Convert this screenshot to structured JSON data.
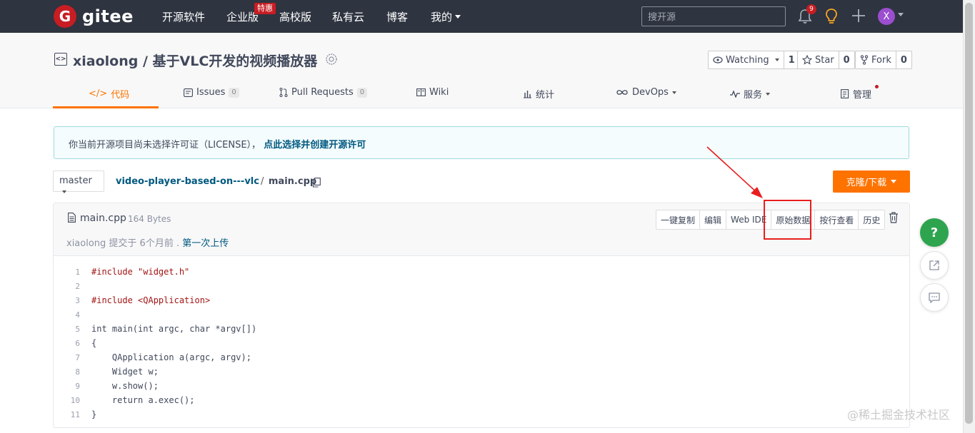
{
  "nav": {
    "logo_mark": "G",
    "logo_text": "gitee",
    "items": [
      "开源软件",
      "企业版",
      "高校版",
      "私有云",
      "博客",
      "我的"
    ],
    "enterprise_badge": "特惠",
    "search_placeholder": "搜开源",
    "notification_count": "9",
    "avatar_letter": "X"
  },
  "project": {
    "title": "xiaolong / 基于VLC开发的视频播放器",
    "watching_label": "Watching",
    "watching_count": "1",
    "star_label": "Star",
    "star_count": "0",
    "fork_label": "Fork",
    "fork_count": "0",
    "tabs": [
      {
        "label": "代码"
      },
      {
        "label": "Issues",
        "count": "0"
      },
      {
        "label": "Pull Requests",
        "count": "0"
      },
      {
        "label": "Wiki"
      },
      {
        "label": "统计"
      },
      {
        "label": "DevOps"
      },
      {
        "label": "服务"
      },
      {
        "label": "管理"
      }
    ]
  },
  "notice": {
    "text": "你当前开源项目尚未选择许可证（LICENSE），",
    "link": "点此选择并创建开源许可"
  },
  "repo": {
    "branch": "master",
    "path_dir": "video-player-based-on---vlc",
    "path_sep": "/",
    "path_file": "main.cpp",
    "clone_label": "克隆/下载"
  },
  "file": {
    "name": "main.cpp",
    "size": "164 Bytes",
    "commit_author": "xiaolong 提交于 6个月前 .",
    "commit_message": "第一次上传",
    "actions": [
      "一键复制",
      "编辑",
      "Web IDE",
      "原始数据",
      "按行查看",
      "历史"
    ]
  },
  "code": {
    "lines": [
      {
        "n": "1",
        "text": "#include \"widget.h\""
      },
      {
        "n": "2",
        "text": ""
      },
      {
        "n": "3",
        "text": "#include <QApplication>"
      },
      {
        "n": "4",
        "text": ""
      },
      {
        "n": "5",
        "text": "int main(int argc, char *argv[])"
      },
      {
        "n": "6",
        "text": "{"
      },
      {
        "n": "7",
        "text": "    QApplication a(argc, argv);"
      },
      {
        "n": "8",
        "text": "    Widget w;"
      },
      {
        "n": "9",
        "text": "    w.show();"
      },
      {
        "n": "10",
        "text": "    return a.exec();"
      },
      {
        "n": "11",
        "text": "}"
      }
    ]
  },
  "float": {
    "help": "?"
  },
  "watermark": "@稀土掘金技术社区",
  "colors": {
    "nav_bg": "#2e3440",
    "brand_red": "#c71d23",
    "accent_orange": "#fe7300",
    "link_blue": "#005980",
    "annotation_red": "#e81e1e",
    "help_green": "#2ea44f"
  }
}
